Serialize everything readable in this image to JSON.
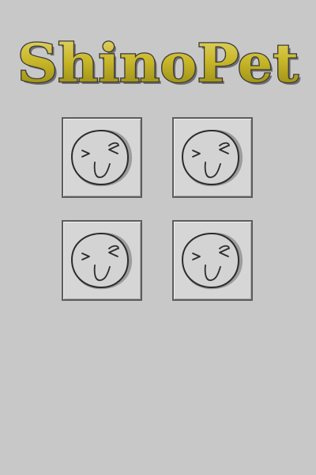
{
  "title": "ShinoPet",
  "colors": {
    "background": "#c8c8c8",
    "logo_fill": "#c9b82a",
    "logo_outline": "#3a3a3a",
    "slot_background": "#d6d6d6",
    "slot_border": "#5c5c5c",
    "face_fill": "#d3d3d3"
  },
  "pets": [
    {
      "icon": "smiling-face-icon"
    },
    {
      "icon": "smiling-face-icon"
    },
    {
      "icon": "smiling-face-icon"
    },
    {
      "icon": "smiling-face-icon"
    }
  ]
}
